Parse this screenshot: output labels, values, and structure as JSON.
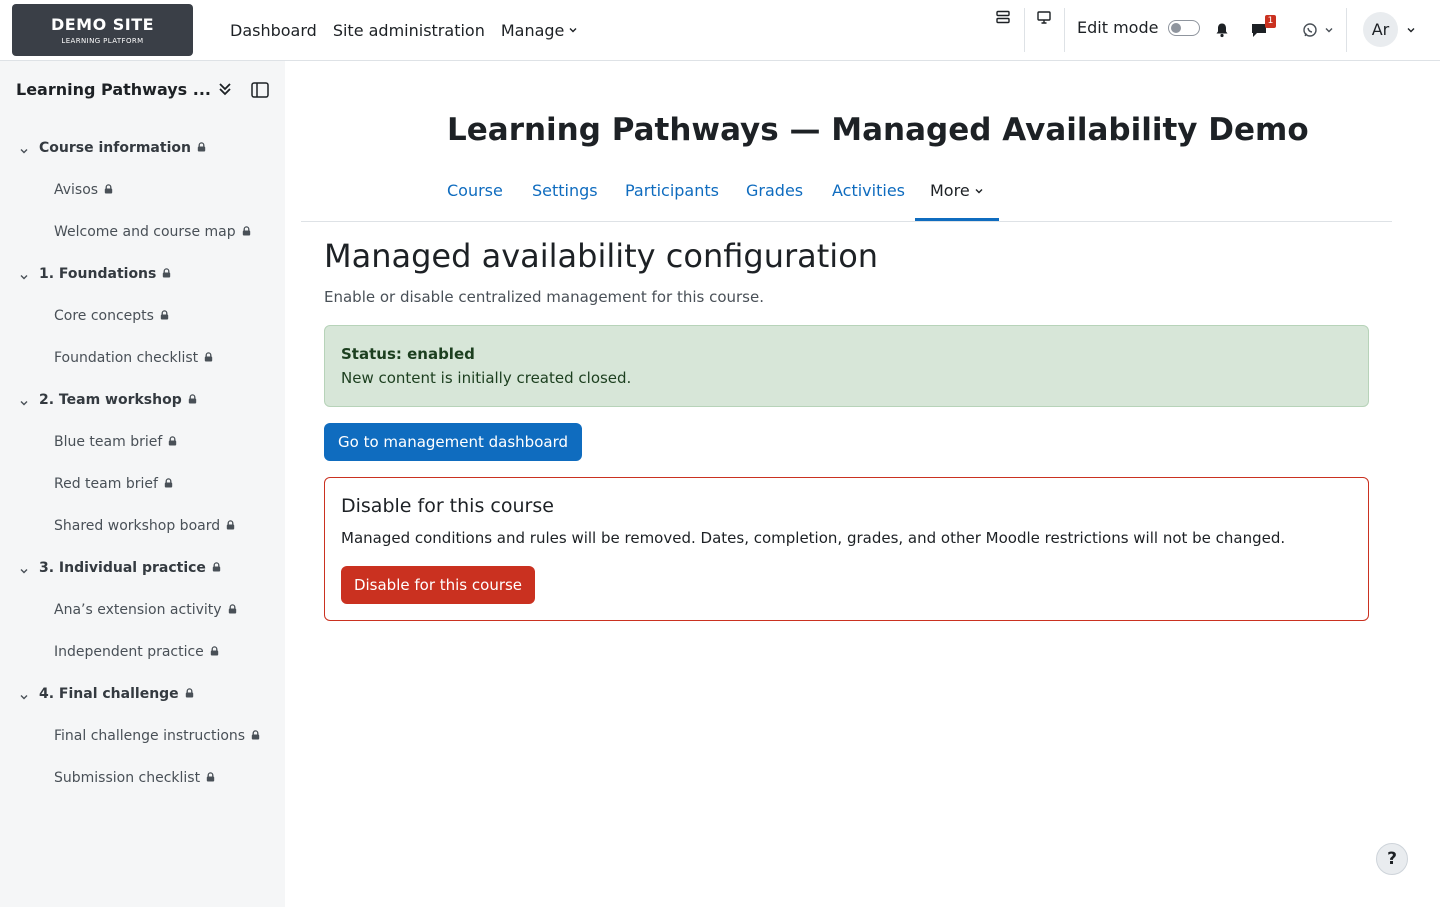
{
  "site": {
    "logo_title": "DEMO SITE",
    "logo_subtitle": "LEARNING PLATFORM"
  },
  "nav": {
    "items": [
      "Dashboard",
      "Site administration",
      "Manage"
    ],
    "edit_mode_label": "Edit mode",
    "messages_count": "1",
    "user_initials": "Ar"
  },
  "sidebar": {
    "title": "Learning Pathways ...",
    "sections": [
      {
        "label": "Course information",
        "items": [
          "Avisos",
          "Welcome and course map"
        ]
      },
      {
        "label": "1. Foundations",
        "items": [
          "Core concepts",
          "Foundation checklist"
        ]
      },
      {
        "label": "2. Team workshop",
        "items": [
          "Blue team brief",
          "Red team brief",
          "Shared workshop board"
        ]
      },
      {
        "label": "3. Individual practice",
        "items": [
          "Ana’s extension activity",
          "Independent practice"
        ]
      },
      {
        "label": "4. Final challenge",
        "items": [
          "Final challenge instructions",
          "Submission checklist"
        ]
      }
    ]
  },
  "course": {
    "title": "Learning Pathways — Managed Availability Demo",
    "tabs": [
      "Course",
      "Settings",
      "Participants",
      "Grades",
      "Activities",
      "More"
    ]
  },
  "main": {
    "heading": "Managed availability configuration",
    "lead": "Enable or disable centralized management for this course.",
    "status_title": "Status: enabled",
    "status_detail": "New content is initially created closed.",
    "dashboard_button": "Go to management dashboard",
    "disable_title": "Disable for this course",
    "disable_description": "Managed conditions and rules will be removed. Dates, completion, grades, and other Moodle restrictions will not be changed.",
    "disable_button": "Disable for this course"
  },
  "help_label": "?"
}
